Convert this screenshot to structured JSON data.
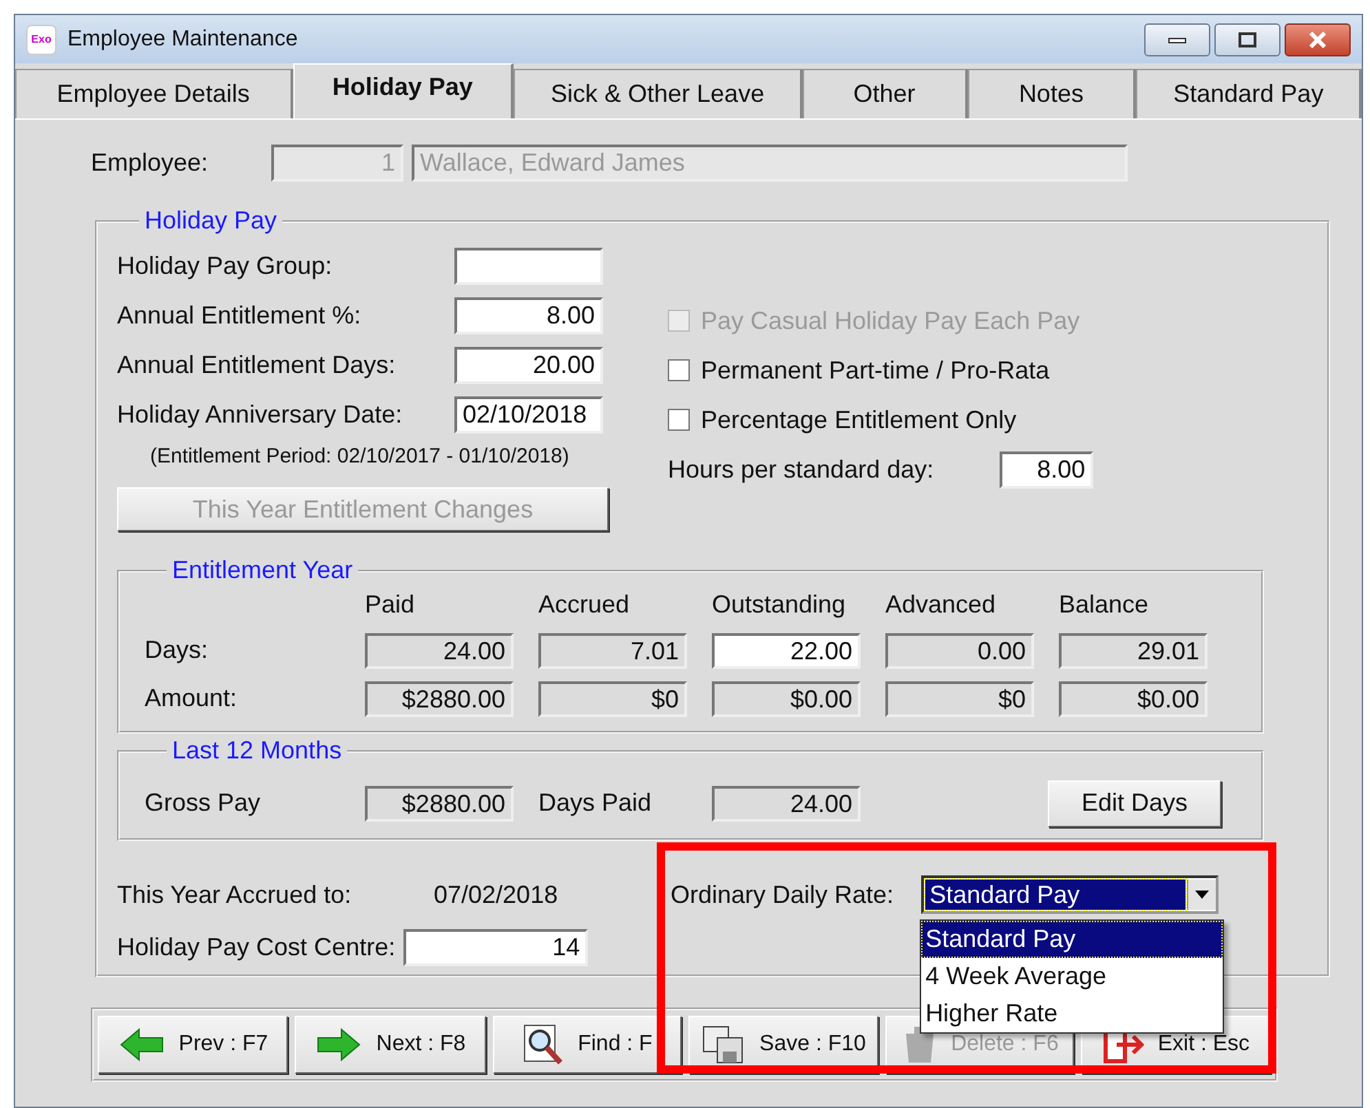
{
  "window": {
    "app_icon_text": "Exo",
    "title": "Employee Maintenance"
  },
  "tabs": [
    {
      "label": "Employee Details",
      "selected": false
    },
    {
      "label": "Holiday Pay",
      "selected": true
    },
    {
      "label": "Sick & Other Leave",
      "selected": false
    },
    {
      "label": "Other",
      "selected": false
    },
    {
      "label": "Notes",
      "selected": false
    },
    {
      "label": "Standard Pay",
      "selected": false
    }
  ],
  "employee": {
    "label": "Employee:",
    "number": "1",
    "name": "Wallace, Edward James"
  },
  "holiday_pay": {
    "title": "Holiday Pay",
    "fields": [
      {
        "label": "Holiday Pay Group:",
        "kind": "number"
      },
      {
        "label": "Annual Entitlement %:",
        "value": "8.00",
        "kind": "number"
      },
      {
        "label": "Annual Entitlement Days:",
        "value": "20.00",
        "kind": "number"
      },
      {
        "label": "Holiday Anniversary Date:",
        "value": "02/10/2018",
        "kind": "date"
      }
    ],
    "period_note": "(Entitlement Period: 02/10/2017 - 01/10/2018)",
    "changes_button": {
      "label": "This Year Entitlement Changes",
      "disabled": true
    },
    "options": [
      {
        "label": "Pay Casual Holiday Pay Each Pay",
        "checked": false,
        "disabled": true
      },
      {
        "label": "Permanent Part-time / Pro-Rata",
        "checked": false,
        "disabled": false
      },
      {
        "label": "Percentage Entitlement Only",
        "checked": false,
        "disabled": false
      }
    ],
    "hours_per_day": {
      "label": "Hours per standard day:",
      "value": "8.00"
    },
    "entitlement_year": {
      "title": "Entitlement Year",
      "columns": [
        "Paid",
        "Accrued",
        "Outstanding",
        "Advanced",
        "Balance"
      ],
      "rows": [
        {
          "label": "Days:",
          "cells": [
            {
              "value": "24.00",
              "editable": false
            },
            {
              "value": "7.01",
              "editable": false
            },
            {
              "value": "22.00",
              "editable": true
            },
            {
              "value": "0.00",
              "editable": false
            },
            {
              "value": "29.01",
              "editable": false
            }
          ]
        },
        {
          "label": "Amount:",
          "cells": [
            {
              "value": "$2880.00",
              "editable": false
            },
            {
              "value": "$0",
              "editable": false
            },
            {
              "value": "$0.00",
              "editable": false
            },
            {
              "value": "$0",
              "editable": false
            },
            {
              "value": "$0.00",
              "editable": false
            }
          ]
        }
      ]
    },
    "last_12_months": {
      "title": "Last 12 Months",
      "gross_pay_label": "Gross Pay",
      "gross_pay": "$2880.00",
      "days_paid_label": "Days Paid",
      "days_paid": "24.00",
      "edit_button": "Edit Days"
    },
    "accrued": {
      "label": "This Year Accrued to:",
      "value": "07/02/2018"
    },
    "cost_centre": {
      "label": "Holiday Pay Cost Centre:",
      "value": "14"
    },
    "ordinary_daily_rate": {
      "label": "Ordinary Daily Rate:",
      "value": "Standard Pay",
      "expanded": true,
      "options": [
        {
          "label": "Standard Pay",
          "selected": true
        },
        {
          "label": "4 Week Average",
          "selected": false
        },
        {
          "label": "Higher Rate",
          "selected": false
        }
      ]
    }
  },
  "buttons": [
    {
      "kind": "prev",
      "label": "Prev : F7",
      "disabled": false
    },
    {
      "kind": "next",
      "label": "Next : F8",
      "disabled": false
    },
    {
      "kind": "find",
      "label": "Find : F",
      "disabled": false
    },
    {
      "kind": "save",
      "label": "Save : F10",
      "disabled": false
    },
    {
      "kind": "delete",
      "label": "Delete : F6",
      "disabled": true
    },
    {
      "kind": "exit",
      "label": "Exit : Esc",
      "disabled": false
    }
  ],
  "highlight_box": true
}
